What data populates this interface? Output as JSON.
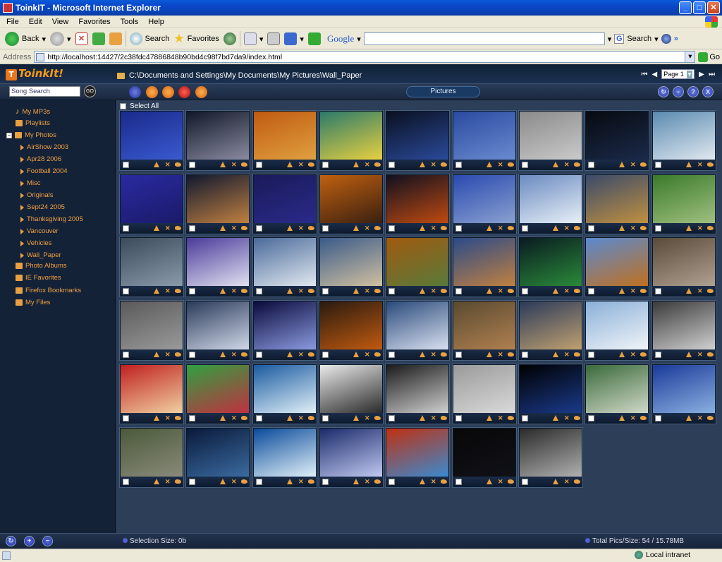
{
  "window": {
    "title": "ToinkIT - Microsoft Internet Explorer"
  },
  "menu": [
    "File",
    "Edit",
    "View",
    "Favorites",
    "Tools",
    "Help"
  ],
  "toolbar": {
    "back_label": "Back",
    "search_label": "Search",
    "favorites_label": "Favorites",
    "google_logo": "Google",
    "google_search_label": "Search"
  },
  "address": {
    "label": "Address",
    "url": "http://localhost:14427/2c38fdc47886848b90bd4c98f7bd7da9/index.html",
    "go_label": "Go"
  },
  "app": {
    "logo": "ToinkIt!",
    "logo_box": "T",
    "path": "C:\\Documents and Settings\\My Documents\\My Pictures\\Wall_Paper",
    "page_select": "Page 1",
    "song_search_placeholder": "Song Search",
    "go_label": "GO",
    "active_tab": "Pictures",
    "select_all": "Select All",
    "selection_size": "Selection Size: 0b",
    "total_pics": "Total Pics/Size:  54 / 15.78MB"
  },
  "sidebar": {
    "items": [
      {
        "label": "My MP3s"
      },
      {
        "label": "Playlists"
      },
      {
        "label": "My Photos"
      },
      {
        "label": "AirShow 2003"
      },
      {
        "label": "Apr28 2006"
      },
      {
        "label": "Football 2004"
      },
      {
        "label": "Misc"
      },
      {
        "label": "Originals"
      },
      {
        "label": "Sept24 2005"
      },
      {
        "label": "Thanksgiving 2005"
      },
      {
        "label": "Vancouver"
      },
      {
        "label": "Vehicles"
      },
      {
        "label": "Wall_Paper"
      },
      {
        "label": "Photo Albums"
      },
      {
        "label": "IE Favorites"
      },
      {
        "label": "Firefox Bookmarks"
      },
      {
        "label": "My Files"
      }
    ]
  },
  "thumbs": [
    [
      "#1a2a8a",
      "#3a5ad0"
    ],
    [
      "#101828",
      "#8a8aa0"
    ],
    [
      "#c05a10",
      "#e0a040"
    ],
    [
      "#2a7a6a",
      "#e8d040"
    ],
    [
      "#0a1020",
      "#2a4a9a"
    ],
    [
      "#2a4aa0",
      "#6a8ad0"
    ],
    [
      "#8a8a8a",
      "#cacaca"
    ],
    [
      "#080a10",
      "#1a2a4a"
    ],
    [
      "#5a8ab0",
      "#e0e8f0"
    ],
    [
      "#2a2aa0",
      "#1a1a6a"
    ],
    [
      "#101830",
      "#c08040"
    ],
    [
      "#1a1a5a",
      "#2a2a8a"
    ],
    [
      "#c06010",
      "#3a2010"
    ],
    [
      "#101020",
      "#c04a10"
    ],
    [
      "#2a4ab0",
      "#8aa0d0"
    ],
    [
      "#6a8ac0",
      "#e8f0f8"
    ],
    [
      "#3a4a6a",
      "#c09040"
    ],
    [
      "#3a7a2a",
      "#a0c080"
    ],
    [
      "#3a4a5a",
      "#8a9aaa"
    ],
    [
      "#4a3a9a",
      "#e0e0f0"
    ],
    [
      "#4a6a9a",
      "#e0e8f0"
    ],
    [
      "#3a5a8a",
      "#d0c0a0"
    ],
    [
      "#a05a10",
      "#5a7a3a"
    ],
    [
      "#2a4a8a",
      "#c08040"
    ],
    [
      "#0a1a20",
      "#2a8a3a"
    ],
    [
      "#5a8ad0",
      "#c07020"
    ],
    [
      "#5a4a3a",
      "#b0a090"
    ],
    [
      "#5a5a5a",
      "#9a9a9a"
    ],
    [
      "#2a3a5a",
      "#d0d8e8"
    ],
    [
      "#0a0a3a",
      "#8a9ae0"
    ],
    [
      "#2a1a10",
      "#c05a10"
    ],
    [
      "#2a4a7a",
      "#d8e0f0"
    ],
    [
      "#5a4a30",
      "#b08050"
    ],
    [
      "#2a3a5a",
      "#c0a070"
    ],
    [
      "#8ab0d8",
      "#f0f4f8"
    ],
    [
      "#3a3a3a",
      "#d0d0d0"
    ],
    [
      "#c02020",
      "#f0d0a0"
    ],
    [
      "#30a040",
      "#c03040"
    ],
    [
      "#1a5aa0",
      "#e0f0f8"
    ],
    [
      "#eaeaea",
      "#2a2a2a"
    ],
    [
      "#1a1a1a",
      "#d0d0d0"
    ],
    [
      "#9a9a9a",
      "#dadada"
    ],
    [
      "#000000",
      "#1a3a8a"
    ],
    [
      "#3a6a3a",
      "#d0d8c8"
    ],
    [
      "#1a3a9a",
      "#8ab0e0"
    ],
    [
      "#4a5a3a",
      "#8a8a7a"
    ],
    [
      "#0a1a3a",
      "#3a6aa0"
    ],
    [
      "#0a4a9a",
      "#e0f0f8"
    ],
    [
      "#1a2a6a",
      "#c0c8f0"
    ],
    [
      "#c03010",
      "#3a8ad0"
    ],
    [
      "#080808",
      "#101018"
    ],
    [
      "#2a2a2a",
      "#b0b0b0"
    ]
  ]
}
